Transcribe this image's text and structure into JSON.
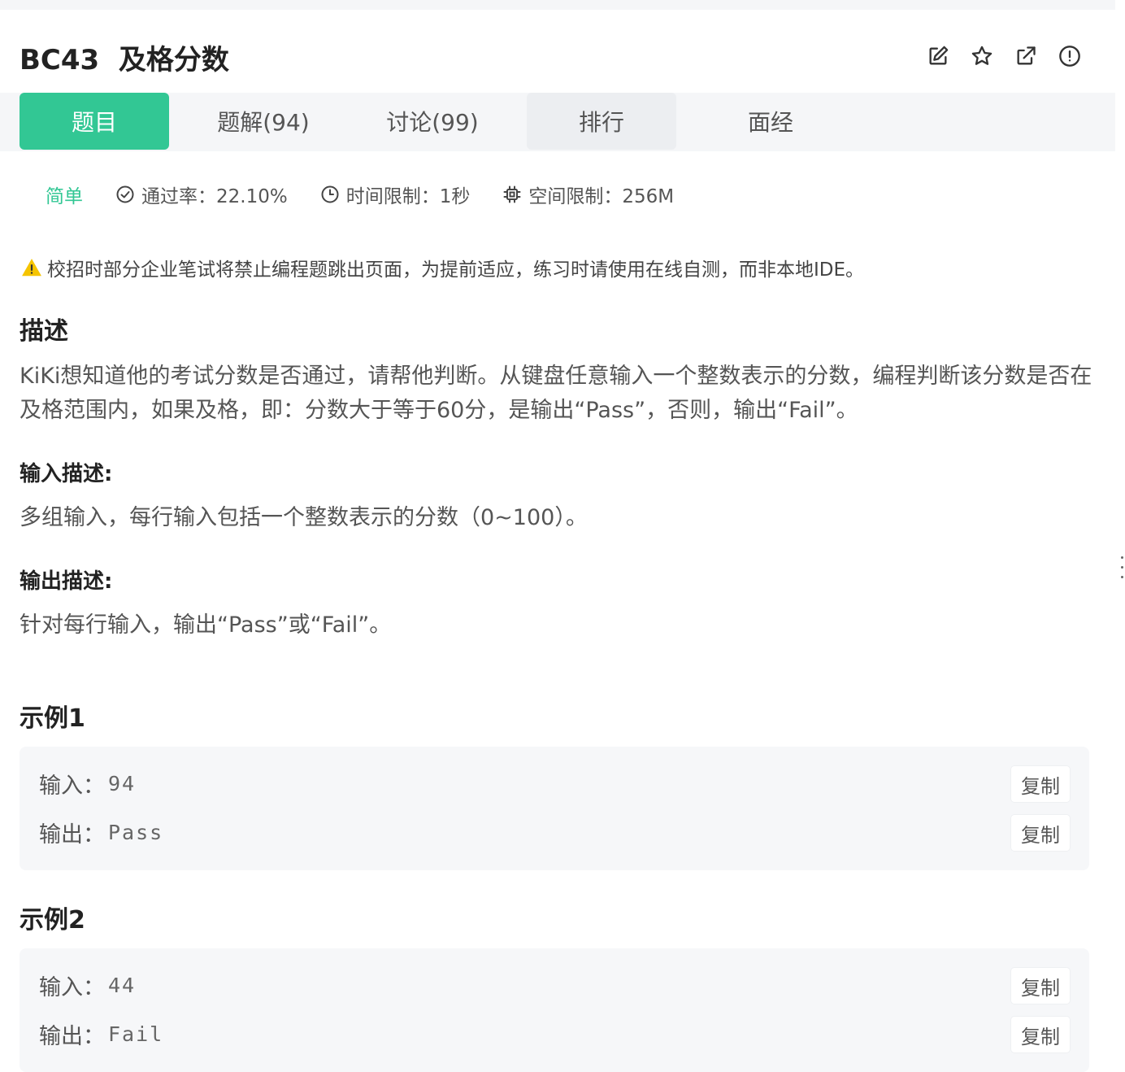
{
  "problem": {
    "code": "BC43",
    "name": "及格分数"
  },
  "toolbar": {
    "icons": [
      "edit-icon",
      "star-icon",
      "share-icon",
      "report-icon"
    ]
  },
  "tabs": [
    {
      "label": "题目",
      "active": true
    },
    {
      "label": "题解(94)"
    },
    {
      "label": "讨论(99)"
    },
    {
      "label": "排行"
    },
    {
      "label": "面经"
    }
  ],
  "meta": {
    "difficulty": "简单",
    "pass_rate": "通过率：22.10%",
    "time_limit": "时间限制：1秒",
    "memory_limit": "空间限制：256M"
  },
  "notice": "校招时部分企业笔试将禁止编程题跳出页面，为提前适应，练习时请使用在线自测，而非本地IDE。",
  "description": {
    "heading": "描述",
    "text": "KiKi想知道他的考试分数是否通过，请帮他判断。从键盘任意输入一个整数表示的分数，编程判断该分数是否在及格范围内，如果及格，即：分数大于等于60分，是输出“Pass”，否则，输出“Fail”。"
  },
  "input_desc": {
    "heading": "输入描述:",
    "text": "多组输入，每行输入包括一个整数表示的分数（0~100）。"
  },
  "output_desc": {
    "heading": "输出描述:",
    "text": "针对每行输入，输出“Pass”或“Fail”。"
  },
  "examples": [
    {
      "heading": "示例1",
      "input_label": "输入：",
      "input_value": "94",
      "output_label": "输出：",
      "output_value": "Pass",
      "copy_label": "复制"
    },
    {
      "heading": "示例2",
      "input_label": "输入：",
      "input_value": "44",
      "output_label": "输出：",
      "output_value": "Fail",
      "copy_label": "复制"
    }
  ],
  "colors": {
    "accent": "#32c794",
    "warning": "#f5c400"
  }
}
